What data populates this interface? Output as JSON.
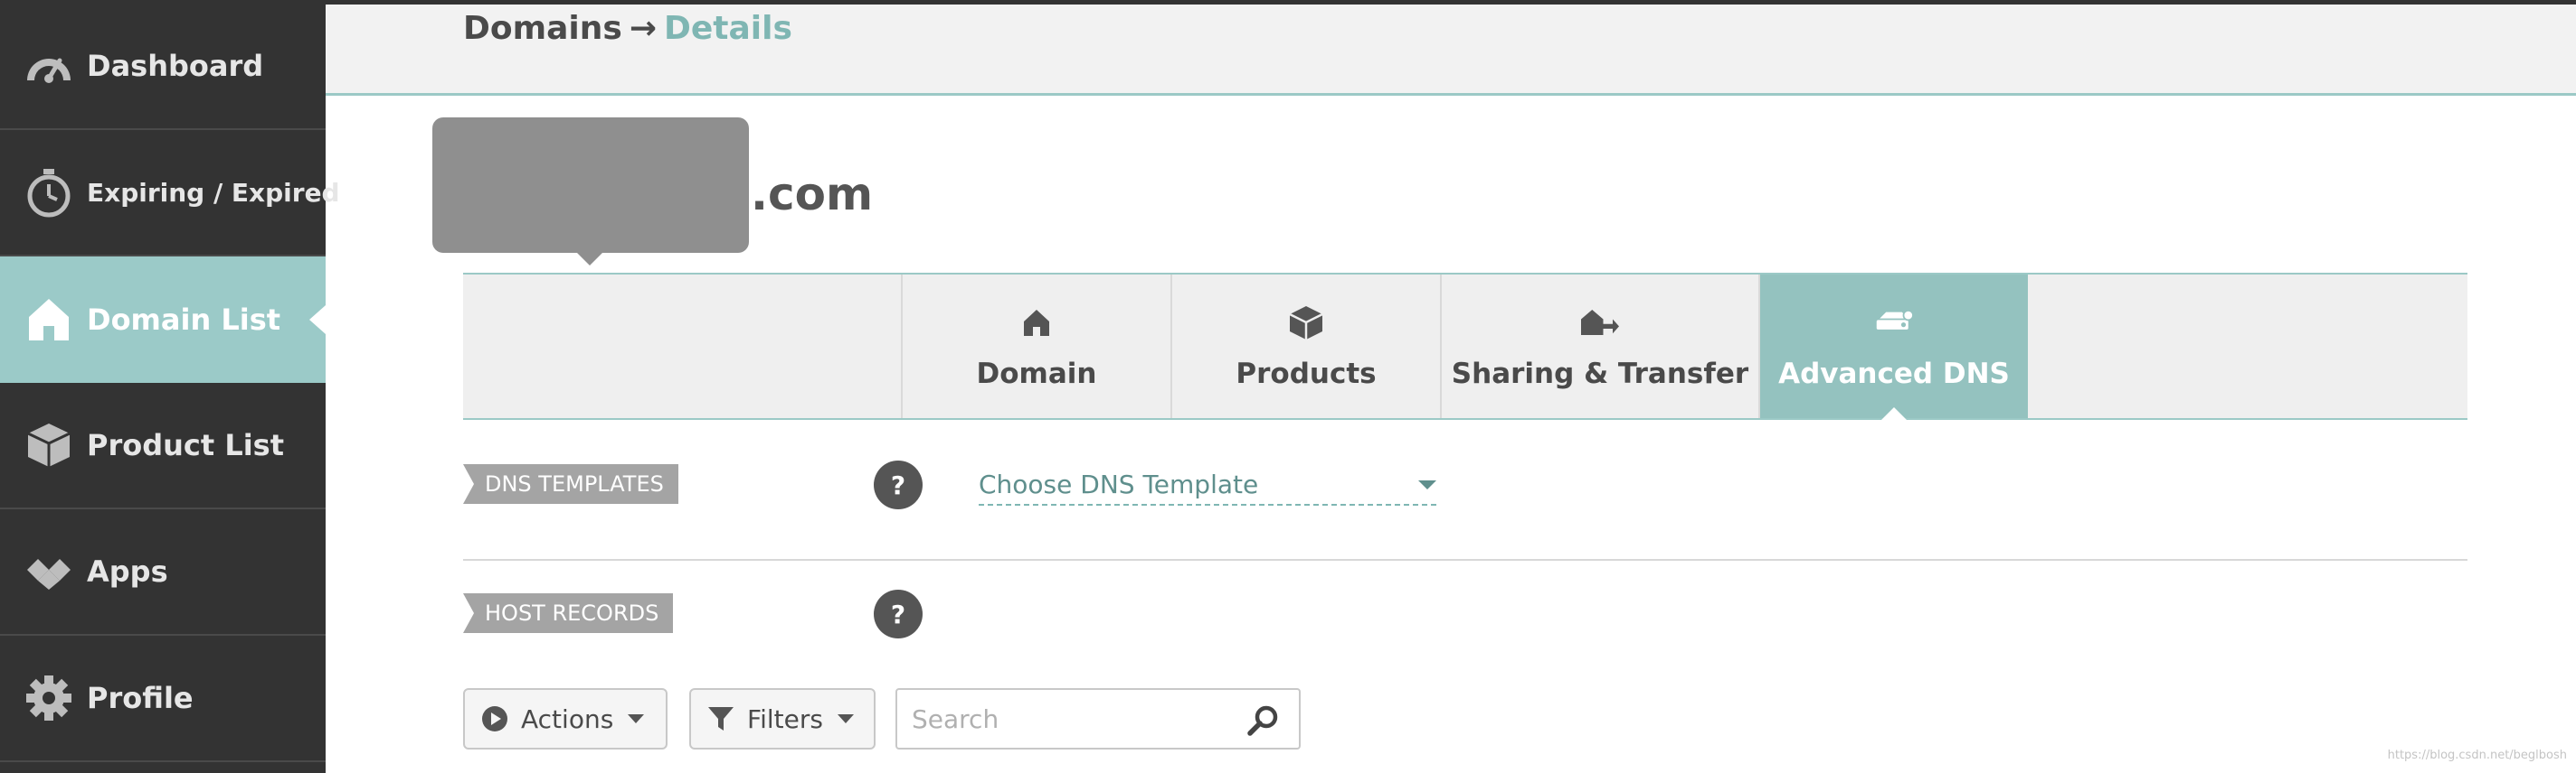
{
  "sidebar": {
    "items": [
      {
        "label": "Dashboard",
        "icon": "speedometer-icon",
        "active": false
      },
      {
        "label": "Expiring / Expired",
        "icon": "stopwatch-icon",
        "active": false
      },
      {
        "label": "Domain List",
        "icon": "home-icon",
        "active": true
      },
      {
        "label": "Product List",
        "icon": "package-icon",
        "active": false
      },
      {
        "label": "Apps",
        "icon": "apps-icon",
        "active": false
      },
      {
        "label": "Profile",
        "icon": "gear-icon",
        "active": false
      }
    ]
  },
  "breadcrumb": {
    "parent": "Domains",
    "separator": "→",
    "current": "Details"
  },
  "domain": {
    "title_visible": ".com",
    "redacted": true
  },
  "tabs": [
    {
      "label": "Domain",
      "icon": "home-icon",
      "active": false
    },
    {
      "label": "Products",
      "icon": "box-icon",
      "active": false
    },
    {
      "label": "Sharing & Transfer",
      "icon": "share-home-icon",
      "active": false
    },
    {
      "label": "Advanced DNS",
      "icon": "server-icon",
      "active": true
    }
  ],
  "dns_templates": {
    "label": "DNS TEMPLATES",
    "help": "?",
    "select_value": "Choose DNS Template"
  },
  "host_records": {
    "label": "HOST RECORDS",
    "help": "?"
  },
  "toolbar": {
    "actions_label": "Actions",
    "filters_label": "Filters",
    "search_placeholder": "Search"
  },
  "watermark": "https://blog.csdn.net/beglbosh",
  "colors": {
    "sidebar_bg": "#333333",
    "accent": "#9bcac8",
    "active_tab": "#94c2bf",
    "section_label": "#a4a4a4"
  }
}
